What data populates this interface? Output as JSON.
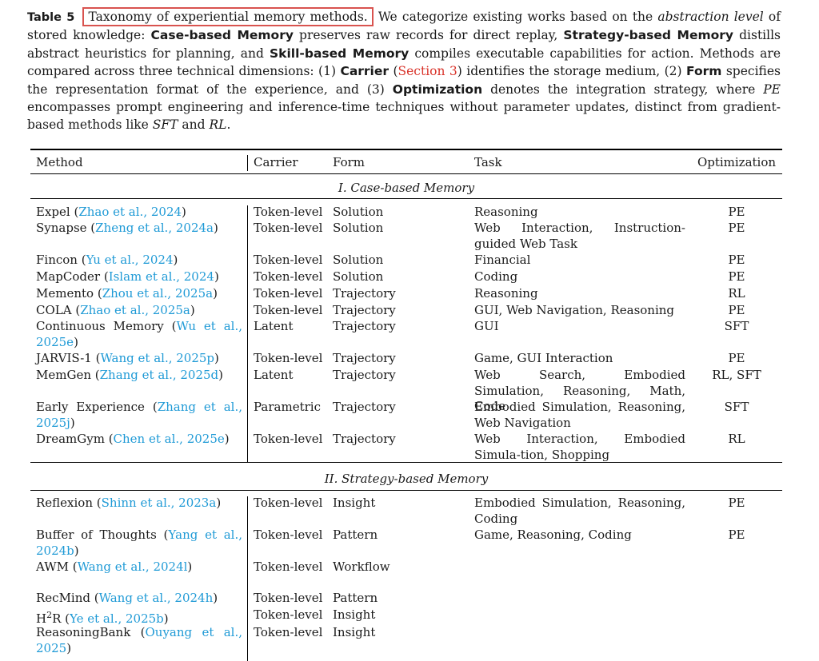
{
  "caption": {
    "label": "Table 5",
    "title": "Taxonomy of experiential memory methods.",
    "s1a": "We categorize existing works based on the ",
    "s1em": "abstraction level",
    "s1b": " of stored knowledge: ",
    "b_case": "Case-based Memory",
    "s2": " preserves raw records for direct replay, ",
    "b_strategy": "Strategy-based Memory",
    "s3": " distills abstract heuristics for planning, and ",
    "b_skill": "Skill-based Memory",
    "s4": " compiles executable capabilities for action. Methods are compared across three technical dimensions: (1) ",
    "b_carrier": "Carrier",
    "s5a": " (",
    "ref_section": "Section 3",
    "s5b": ") identifies the storage medium, (2) ",
    "b_form": "Form",
    "s6": " specifies the representation format of the experience, and (3) ",
    "b_optimization": "Optimization",
    "s7": " denotes the integration strategy, where ",
    "em_pe": "PE",
    "s8": " encompasses prompt engineering and inference-time techniques without parameter updates, distinct from gradient-based methods like ",
    "em_sft": "SFT",
    "s9": " and ",
    "em_rl": "RL",
    "s10": "."
  },
  "table": {
    "headers": [
      "Method",
      "Carrier",
      "Form",
      "Task",
      "Optimization"
    ],
    "sections": [
      {
        "title": "I. Case-based Memory",
        "rows": [
          {
            "name": "Expel",
            "cite": "Zhao et al., 2024",
            "carrier": "Token-level",
            "form": "Solution",
            "task": "Reasoning",
            "opt": "PE"
          },
          {
            "name": "Synapse",
            "cite": "Zheng et al., 2024a",
            "carrier": "Token-level",
            "form": "Solution",
            "task": "Web Interaction, Instruction-guided Web Task",
            "opt": "PE"
          },
          {
            "name": "Fincon",
            "cite": "Yu et al., 2024",
            "carrier": "Token-level",
            "form": "Solution",
            "task": "Financial",
            "opt": "PE"
          },
          {
            "name": "MapCoder",
            "cite": "Islam et al., 2024",
            "carrier": "Token-level",
            "form": "Solution",
            "task": "Coding",
            "opt": "PE"
          },
          {
            "name": "Memento",
            "cite": "Zhou et al., 2025a",
            "carrier": "Token-level",
            "form": "Trajectory",
            "task": "Reasoning",
            "opt": "RL"
          },
          {
            "name": "COLA",
            "cite": "Zhao et al., 2025a",
            "carrier": "Token-level",
            "form": "Trajectory",
            "task": "GUI, Web Navigation, Reasoning",
            "opt": "PE"
          },
          {
            "name": "Continuous Memory",
            "cite": "Wu et al., 2025e",
            "carrier": "Latent",
            "form": "Trajectory",
            "task": "GUI",
            "opt": "SFT"
          },
          {
            "name": "JARVIS-1",
            "cite": "Wang et al., 2025p",
            "carrier": "Token-level",
            "form": "Trajectory",
            "task": "Game, GUI Interaction",
            "opt": "PE"
          },
          {
            "name": "MemGen",
            "cite": "Zhang et al., 2025d",
            "carrier": "Latent",
            "form": "Trajectory",
            "task": "Web Search, Embodied Simulation, Reasoning, Math, Code",
            "opt": "RL, SFT"
          },
          {
            "name": "Early Experience",
            "cite": "Zhang et al., 2025j",
            "carrier": "Parametric",
            "form": "Trajectory",
            "task": "Embodied Simulation, Reasoning, Web Navigation",
            "opt": "SFT"
          },
          {
            "name": "DreamGym",
            "cite": "Chen et al., 2025e",
            "carrier": "Token-level",
            "form": "Trajectory",
            "task": "Web Interaction, Embodied Simula-tion, Shopping",
            "opt": "RL"
          }
        ]
      },
      {
        "title": "II. Strategy-based Memory",
        "rows": [
          {
            "name": "Reflexion",
            "cite": "Shinn et al., 2023a",
            "carrier": "Token-level",
            "form": "Insight",
            "task": "Embodied Simulation, Reasoning, Coding",
            "opt": "PE"
          },
          {
            "name": "Buffer of Thoughts",
            "cite": "Yang et al., 2024b",
            "carrier": "Token-level",
            "form": "Pattern",
            "task": "Game, Reasoning, Coding",
            "opt": "PE"
          },
          {
            "name": "AWM",
            "cite": "Wang et al., 2024l",
            "carrier": "Token-level",
            "form": "Workflow",
            "task": "",
            "opt": ""
          },
          {
            "name": "RecMind",
            "cite": "Wang et al., 2024h",
            "carrier": "Token-level",
            "form": "Pattern",
            "task": "",
            "opt": ""
          },
          {
            "name": "H",
            "name_sup": "2",
            "name_tail": "R",
            "cite": "Ye et al., 2025b",
            "carrier": "Token-level",
            "form": "Insight",
            "task": "",
            "opt": ""
          },
          {
            "name": "ReasoningBank",
            "cite": "Ouyang et al., 2025",
            "carrier": "Token-level",
            "form": "Insight",
            "task": "",
            "opt": ""
          }
        ]
      }
    ]
  }
}
